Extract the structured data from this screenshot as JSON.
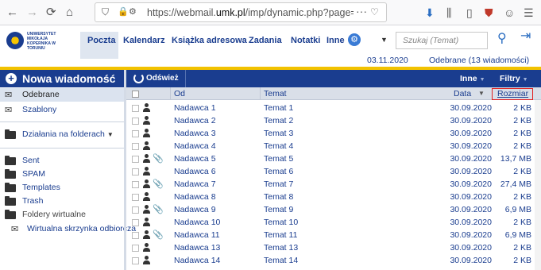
{
  "browser": {
    "url_prefix": "https://webmail.",
    "url_domain": "umk.pl",
    "url_suffix": "/imp/dynamic.php?page=mailbox"
  },
  "header": {
    "logo_text": "UNIWERSYTET MIKOŁAJA KOPERNIKA W TORUNIU",
    "menu": [
      "Poczta",
      "Kalendarz",
      "Książka adresowa",
      "Zadania",
      "Notatki",
      "Inne"
    ],
    "search_placeholder": "Szukaj (Temat)",
    "date": "03.11.2020",
    "folder_status": "Odebrane (13 wiadomości)"
  },
  "sidebar": {
    "new_message": "Nowa wiadomość",
    "inbox": "Odebrane",
    "templates_pl": "Szablony",
    "folder_actions": "Działania na folderach",
    "folders": [
      "Sent",
      "SPAM",
      "Templates",
      "Trash"
    ],
    "virtual_folders": "Foldery wirtualne",
    "virtual_inbox": "Wirtualna skrzynka odbiorcza"
  },
  "toolbar": {
    "refresh": "Odśwież",
    "other": "Inne",
    "filters": "Filtry"
  },
  "columns": {
    "from": "Od",
    "subject": "Temat",
    "date": "Data",
    "size": "Rozmiar"
  },
  "messages": [
    {
      "from": "Nadawca 1",
      "subject": "Temat 1",
      "date": "30.09.2020",
      "size": "2 KB",
      "attachment": false
    },
    {
      "from": "Nadawca 2",
      "subject": "Temat 2",
      "date": "30.09.2020",
      "size": "2 KB",
      "attachment": false
    },
    {
      "from": "Nadawca 3",
      "subject": "Temat 3",
      "date": "30.09.2020",
      "size": "2 KB",
      "attachment": false
    },
    {
      "from": "Nadawca 4",
      "subject": "Temat 4",
      "date": "30.09.2020",
      "size": "2 KB",
      "attachment": false
    },
    {
      "from": "Nadawca 5",
      "subject": "Temat 5",
      "date": "30.09.2020",
      "size": "13,7 MB",
      "attachment": true
    },
    {
      "from": "Nadawca 6",
      "subject": "Temat 6",
      "date": "30.09.2020",
      "size": "2 KB",
      "attachment": false
    },
    {
      "from": "Nadawca 7",
      "subject": "Temat 7",
      "date": "30.09.2020",
      "size": "27,4 MB",
      "attachment": true
    },
    {
      "from": "Nadawca 8",
      "subject": "Temat 8",
      "date": "30.09.2020",
      "size": "2 KB",
      "attachment": false
    },
    {
      "from": "Nadawca 9",
      "subject": "Temat 9",
      "date": "30.09.2020",
      "size": "6,9 MB",
      "attachment": true
    },
    {
      "from": "Nadawca 10",
      "subject": "Temat 10",
      "date": "30.09.2020",
      "size": "2 KB",
      "attachment": false
    },
    {
      "from": "Nadawca 11",
      "subject": "Temat 11",
      "date": "30.09.2020",
      "size": "6,9 MB",
      "attachment": true
    },
    {
      "from": "Nadawca 13",
      "subject": "Temat 13",
      "date": "30.09.2020",
      "size": "2 KB",
      "attachment": false
    },
    {
      "from": "Nadawca 14",
      "subject": "Temat 14",
      "date": "30.09.2020",
      "size": "2 KB",
      "attachment": false
    }
  ],
  "colors": {
    "brand_blue": "#1a3d8f",
    "accent_gold": "#f2c200",
    "highlight_red": "#e02020"
  }
}
